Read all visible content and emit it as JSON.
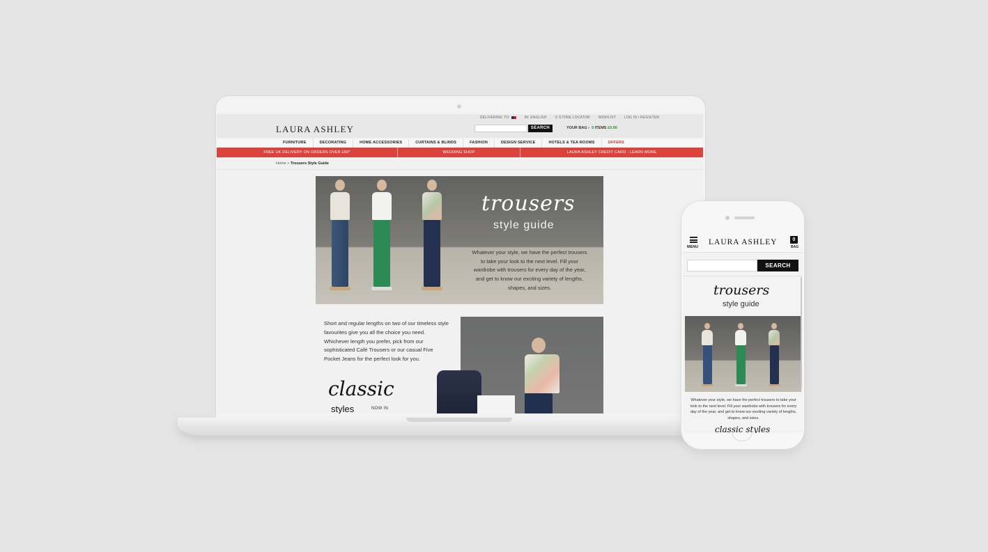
{
  "desktop": {
    "utility": {
      "delivering_to": "DELIVERING TO:",
      "language": "IN: ENGLISH",
      "store_locator": "STORE LOCATOR",
      "wishlist": "WISHLIST",
      "login": "LOG IN / REGISTER"
    },
    "logo": "LAURA ASHLEY",
    "search_button": "SEARCH",
    "search_placeholder": "",
    "bag": {
      "label": "YOUR BAG",
      "count": "0",
      "items_label": "ITEMS",
      "total": "£0.00"
    },
    "nav": [
      "FURNITURE",
      "DECORATING",
      "HOME ACCESSORIES",
      "CURTAINS & BLINDS",
      "FASHION",
      "DESIGN SERVICE",
      "HOTELS & TEA ROOMS",
      "OFFERS"
    ],
    "promos": [
      "FREE UK DELIVERY ON ORDERS OVER £50*",
      "WEDDING SHOP",
      "LAURA ASHLEY CREDIT CARD - LEARN MORE"
    ],
    "breadcrumb": {
      "home": "Home",
      "separator": ">",
      "current": "Trousers Style Guide"
    },
    "hero": {
      "script_title": "trousers",
      "subtitle": "style guide",
      "text": "Whatever your style, we have the perfect trousers to take your look to the next level. Fill your wardrobe with trousers for every day of the year, and get to know our exciting variety of lengths, shapes, and sizes."
    },
    "intro_text": "Short and regular lengths on two of our timeless style favourites give you all the choice you need. Whichever length you prefer, pick from our sophisticated Café Trousers or our casual Five Pocket Jeans for the perfect look for you.",
    "classic": {
      "script": "classic",
      "styles": "styles",
      "now_in": "NOW IN"
    }
  },
  "mobile": {
    "menu_label": "MENU",
    "logo": "LAURA ASHLEY",
    "bag_count": "0",
    "bag_label": "BAG",
    "search_button": "SEARCH",
    "search_placeholder": "",
    "script_title": "trousers",
    "subtitle": "style guide",
    "text": "Whatever your style, we have the perfect trousers to take your look to the next level. Fill your wardrobe with trousers for every day of the year, and get to know our exciting variety of lengths, shapes, and sizes.",
    "classic_title": "classic styles"
  },
  "colors": {
    "background": "#e4e4e4",
    "promo_red": "#d9433b",
    "offers_red": "#c0392b",
    "bag_green": "#2a8b3c",
    "button_black": "#111111"
  },
  "icons": [
    "flag-icon",
    "map-pin-icon",
    "hamburger-menu-icon",
    "shopping-bag-icon",
    "camera-icon"
  ]
}
